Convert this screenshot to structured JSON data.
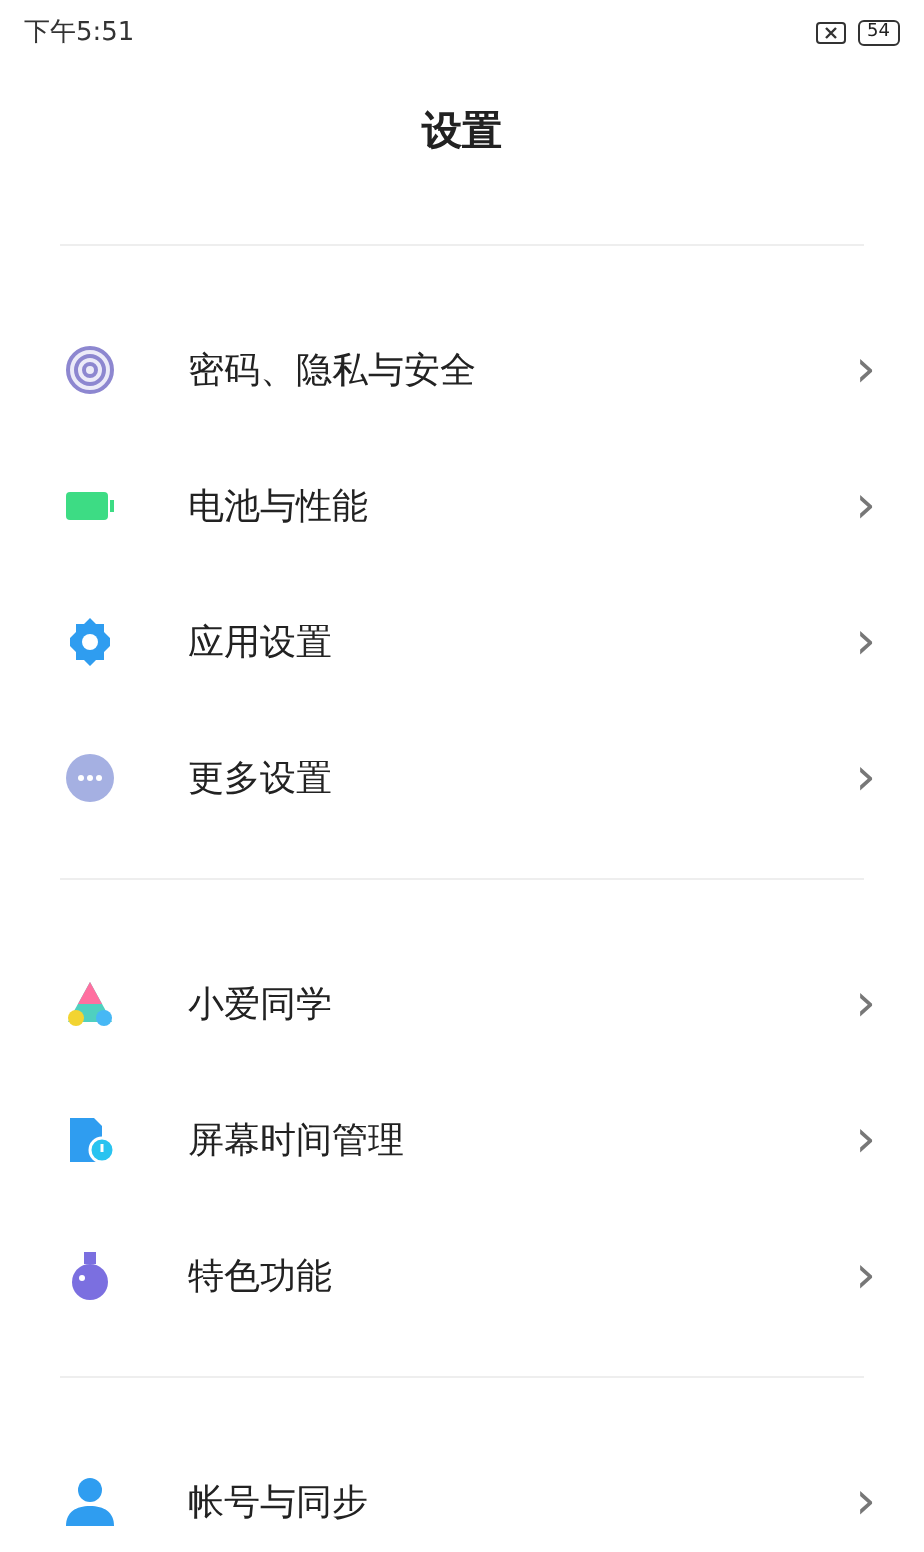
{
  "status_bar": {
    "time": "下午5:51",
    "battery": "54"
  },
  "title": "设置",
  "sections": [
    {
      "items": [
        {
          "kind": "fingerprint",
          "label": "密码、隐私与安全",
          "chevron": "›"
        },
        {
          "kind": "battery",
          "label": "电池与性能",
          "chevron": "›"
        },
        {
          "kind": "gear",
          "label": "应用设置",
          "chevron": "›"
        },
        {
          "kind": "more",
          "label": "更多设置",
          "chevron": "›"
        }
      ]
    },
    {
      "items": [
        {
          "kind": "assistant",
          "label": "小爱同学",
          "chevron": "›"
        },
        {
          "kind": "screen_time",
          "label": "屏幕时间管理",
          "chevron": "›"
        },
        {
          "kind": "flask",
          "label": "特色功能",
          "chevron": "›"
        }
      ]
    },
    {
      "items": [
        {
          "kind": "account",
          "label": "帐号与同步",
          "chevron": "›"
        }
      ]
    }
  ]
}
